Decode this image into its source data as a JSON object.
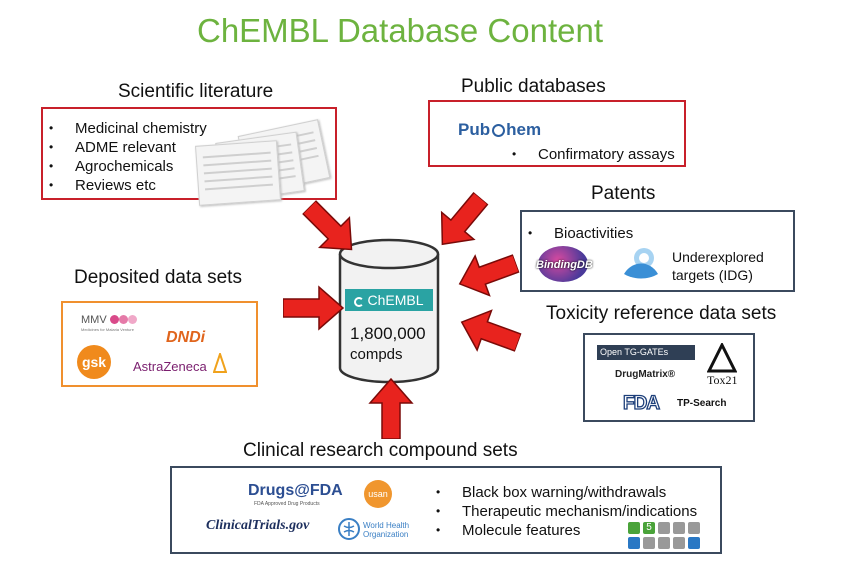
{
  "title": "ChEMBL Database Content",
  "sources": {
    "literature": {
      "heading": "Scientific literature",
      "items": [
        "Medicinal chemistry",
        "ADME relevant",
        "Agrochemicals",
        "Reviews etc"
      ]
    },
    "public_db": {
      "heading": "Public databases",
      "logo_pre": "Pub",
      "logo_post": "hem",
      "items": [
        "Confirmatory assays"
      ]
    },
    "patents": {
      "heading": "Patents",
      "items": [
        "Bioactivities"
      ],
      "bindingdb_logo": "BindingDB",
      "idg_label_line1": "Underexplored",
      "idg_label_line2": "targets (IDG)"
    },
    "deposited": {
      "heading": "Deposited data sets",
      "mmv_logo": "MMV",
      "mmv_sub": "Medicines for Malaria Venture",
      "dndi_logo": "DNDi",
      "gsk_logo": "gsk",
      "az_logo": "AstraZeneca"
    },
    "toxicity": {
      "heading": "Toxicity reference data sets",
      "tggates_logo": "Open TG-GATEs",
      "drugmatrix_logo": "DrugMatrix®",
      "tox21_logo": "Tox21",
      "fda_logo": "FDA",
      "tpsearch_logo": "TP-Search"
    },
    "clinical": {
      "heading": "Clinical research compound sets",
      "drugsfda_logo": "Drugs@FDA",
      "drugsfda_sub": "FDA Approved Drug Products",
      "usan_logo": "usan",
      "clinicaltrials_logo": "ClinicalTrials.gov",
      "who_logo_line1": "World Health",
      "who_logo_line2": "Organization",
      "items": [
        "Black box warning/withdrawals",
        "Therapeutic mechanism/indications",
        "Molecule features"
      ],
      "feature_icon_number": "5"
    }
  },
  "database": {
    "logo": "ChEMBL",
    "count": "1,800,000",
    "unit": "compds"
  },
  "colors": {
    "title": "#6db33f",
    "arrow": "#e8231e",
    "literature_border": "#c8202a",
    "navy_border": "#3b4a5e",
    "deposited_border": "#f0902e",
    "chembl_teal": "#2aa3a3"
  }
}
